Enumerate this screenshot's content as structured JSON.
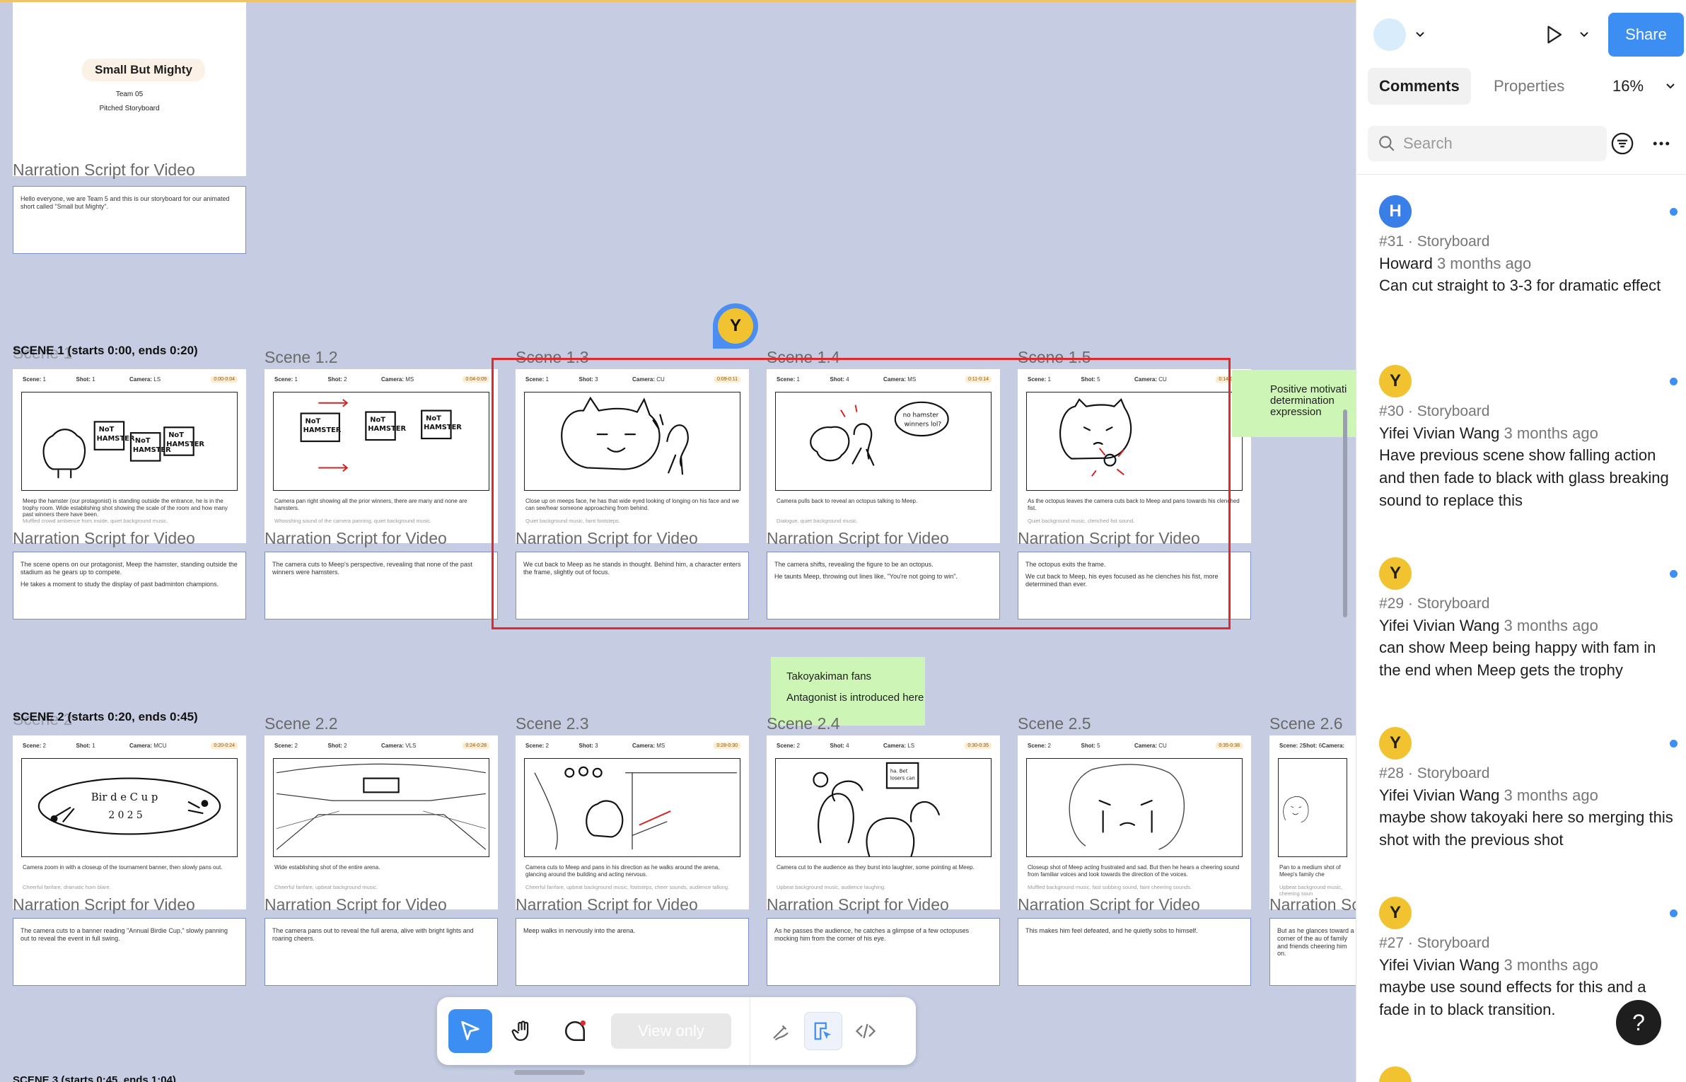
{
  "cover": {
    "title": "Small But Mighty",
    "team": "Team 05",
    "subtitle": "Pitched Storyboard",
    "narration_title": "Narration Script for Video",
    "narration": "Hello everyone, we are Team 5 and this is our storyboard for our animated short called \"Small but Mighty\"."
  },
  "scene1": {
    "heading": "SCENE 1 (starts 0:00, ends 0:20)",
    "ghost": "Scene 1"
  },
  "scene2": {
    "heading": "SCENE 2 (starts 0:20, ends 0:45)",
    "ghost": "Scene 2"
  },
  "scene3_heading": "SCENE 3 (starts 0:45, ends 1:04)",
  "labels": {
    "scene": "Scene:",
    "shot": "Shot:",
    "camera": "Camera:",
    "narration_title": "Narration Script for Video"
  },
  "row1": [
    {
      "title": "",
      "scene": "1",
      "shot": "1",
      "camera": "LS",
      "time": "0:00-0:04",
      "desc": "Meep the hamster (our protagonist) is standing outside the entrance, he is in the trophy room. Wide establishing shot showing the scale of the room and how many past winners there have been.",
      "sound": "Muffled crowd ambience from inside, quiet background music.",
      "narr1": "The scene opens on our protagonist, Meep the hamster, standing outside the stadium as he gears up to compete.",
      "narr2": "He takes a moment to study the display of past badminton champions."
    },
    {
      "title": "Scene 1.2",
      "scene": "1",
      "shot": "2",
      "camera": "MS",
      "time": "0:04-0:09",
      "desc": "Camera pan right showing all the prior winners, there are many and none are hamsters.",
      "sound": "Whooshing sound of the camera panning, quiet background music.",
      "narr1": "The camera cuts to Meep's perspective, revealing that none of the past winners were hamsters.",
      "narr2": ""
    },
    {
      "title": "Scene 1.3",
      "scene": "1",
      "shot": "3",
      "camera": "CU",
      "time": "0:09-0:11",
      "desc": "Close up on meeps face, he has that wide eyed looking of longing on his face and we can see/hear someone approaching from behind.",
      "sound": "Quiet background music, faint footsteps.",
      "narr1": "We cut back to Meep as he stands in thought. Behind him, a character enters the frame, slightly out of focus.",
      "narr2": ""
    },
    {
      "title": "Scene 1.4",
      "scene": "1",
      "shot": "4",
      "camera": "MS",
      "time": "0:11-0:14",
      "desc": "Camera pulls back to reveal an octopus talking to Meep.",
      "sound": "Dialogue, quiet background music.",
      "narr1": "The camera shifts, revealing the figure to be an octopus.",
      "narr2": "He taunts Meep, throwing out lines like, \"You're not going to win\"."
    },
    {
      "title": "Scene 1.5",
      "scene": "1",
      "shot": "5",
      "camera": "CU",
      "time": "0:14-0:20",
      "desc": "As the octopus leaves the camera cuts back to Meep and pans towards his clenched fist.",
      "sound": "Quiet background music, clenched fist sound.",
      "narr1": "The octopus exits the frame.",
      "narr2": "We cut back to Meep, his eyes focused as he clenches his fist, more determined than ever."
    }
  ],
  "row2": [
    {
      "title": "",
      "scene": "2",
      "shot": "1",
      "camera": "MCU",
      "time": "0:20-0:24",
      "desc": "Camera zoom in with a closeup of the tournament banner, then slowly pans out.",
      "sound": "Cheerful fanfare, dramatic horn blare.",
      "narr1": "The camera cuts to a banner reading \"Annual Birdie Cup,\" slowly panning out to reveal the event in full swing.",
      "narr2": ""
    },
    {
      "title": "Scene 2.2",
      "scene": "2",
      "shot": "2",
      "camera": "VLS",
      "time": "0:24-0:28",
      "desc": "Wide establishing shot of the entire arena.",
      "sound": "Cheerful fanfare, upbeat background music.",
      "narr1": "The camera pans out to reveal the full arena, alive with bright lights and roaring cheers.",
      "narr2": ""
    },
    {
      "title": "Scene 2.3",
      "scene": "2",
      "shot": "3",
      "camera": "MS",
      "time": "0:28-0:30",
      "desc": "Camera cuts to Meep and pans in his direction as he walks around the arena, glancing around the building and acting nervous.",
      "sound": "Cheerful fanfare, upbeat background music, footsteps, cheer sounds, audience talking.",
      "narr1": "Meep walks in nervously into the arena.",
      "narr2": ""
    },
    {
      "title": "Scene 2.4",
      "scene": "2",
      "shot": "4",
      "camera": "LS",
      "time": "0:30-0:35",
      "desc": "Camera cut to the audience as they burst into laughter, some pointing at Meep.",
      "sound": "Upbeat background music, audience laughing.",
      "narr1": "As he passes the audience, he catches a glimpse of a few octopuses mocking him from the corner of his eye.",
      "narr2": ""
    },
    {
      "title": "Scene 2.5",
      "scene": "2",
      "shot": "5",
      "camera": "CU",
      "time": "0:35-0:38",
      "desc": "Closeup shot of Meep acting frustrated and sad. But then he hears a cheering sound from familiar voices and look towards the direction of the voices.",
      "sound": "Muffled background music, fast sobbing sound, faint cheering sounds.",
      "narr1": "This makes him feel defeated, and he quietly sobs to himself.",
      "narr2": ""
    },
    {
      "title": "Scene 2.6",
      "scene": "2",
      "shot": "6",
      "camera": "",
      "time": "",
      "desc": "Pan to a medium shot of Meep's family che",
      "sound": "Upbeat background music, cheering soun",
      "narr1": "But as he glances toward a corner of the au of family and friends cheering him on.",
      "narr2": ""
    }
  ],
  "stickies": {
    "positive": "Positive motivati determination expression",
    "tako1": "Takoyakiman fans",
    "tako2": "Antagonist is introduced here"
  },
  "avatar_canvas": "Y",
  "toolbar": {
    "view_only": "View only"
  },
  "panel": {
    "share": "Share",
    "tab_comments": "Comments",
    "tab_properties": "Properties",
    "zoom": "16%",
    "search_placeholder": "Search",
    "help": "?"
  },
  "comments": [
    {
      "initial": "H",
      "color": "#3a7ee8",
      "id": "#31 · Storyboard",
      "author": "Howard",
      "ago": "3 months ago",
      "body": "Can cut straight to 3-3 for dramatic effect"
    },
    {
      "initial": "Y",
      "color": "#f2c331",
      "id": "#30 · Storyboard",
      "author": "Yifei Vivian Wang",
      "ago": "3 months ago",
      "body": "Have previous scene show falling action and then fade to black with glass breaking sound to replace this"
    },
    {
      "initial": "Y",
      "color": "#f2c331",
      "id": "#29 · Storyboard",
      "author": "Yifei Vivian Wang",
      "ago": "3 months ago",
      "body": "can show Meep being happy with fam in the end when Meep gets the trophy"
    },
    {
      "initial": "Y",
      "color": "#f2c331",
      "id": "#28 · Storyboard",
      "author": "Yifei Vivian Wang",
      "ago": "3 months ago",
      "body": "maybe show takoyaki here so merging this shot with the previous shot"
    },
    {
      "initial": "Y",
      "color": "#f2c331",
      "id": "#27 · Storyboard",
      "author": "Yifei Vivian Wang",
      "ago": "3 months ago",
      "body": "maybe use sound effects for this and a fade in to black transition."
    }
  ]
}
